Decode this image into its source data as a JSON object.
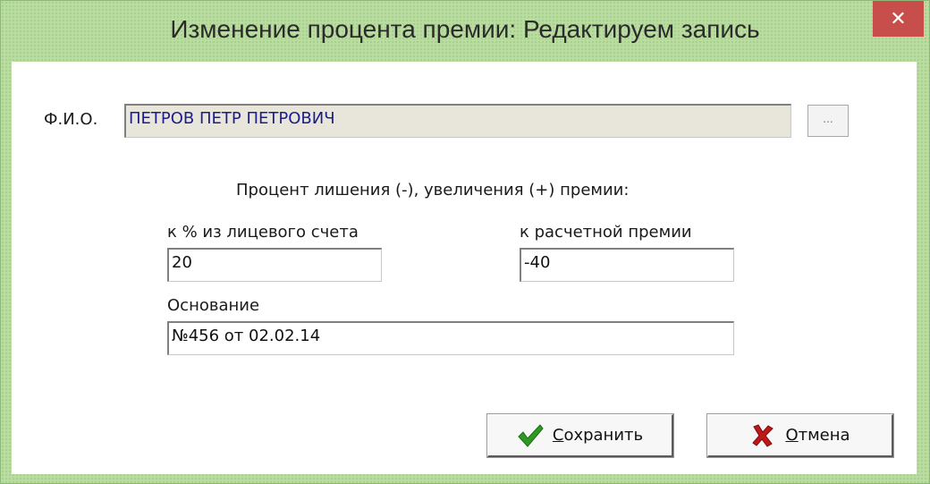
{
  "window": {
    "title": "Изменение процента премии: Редактируем запись",
    "close_symbol": "✕"
  },
  "form": {
    "fio_label": "Ф.И.О.",
    "fio_value": "ПЕТРОВ ПЕТР ПЕТРОВИЧ",
    "browse_label": "...",
    "percent_heading": "Процент лишения (-), увеличения (+) премии:",
    "account_label": "к % из лицевого счета",
    "account_value": "20",
    "bonus_label": "к расчетной премии",
    "bonus_value": "-40",
    "basis_label": "Основание",
    "basis_value": "№456 от 02.02.14"
  },
  "buttons": {
    "save": {
      "accel": "С",
      "rest": "охранить",
      "icon": "checkmark-icon"
    },
    "cancel": {
      "accel": "О",
      "rest": "тмена",
      "icon": "x-mark-icon"
    }
  },
  "colors": {
    "frame": "#b9dca0",
    "close": "#c74e4a",
    "readonly_field": "#e8e6da",
    "readonly_text": "#1c1c8c",
    "check": "#2f9a23",
    "cross": "#c01818"
  }
}
